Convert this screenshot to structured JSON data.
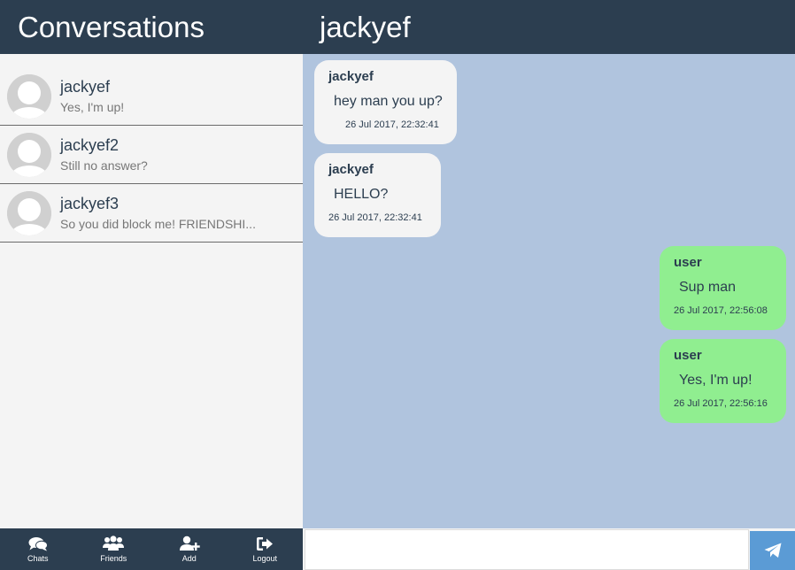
{
  "sidebar": {
    "title": "Conversations",
    "conversations": [
      {
        "name": "jackyef",
        "preview": "Yes, I'm up!"
      },
      {
        "name": "jackyef2",
        "preview": "Still no answer?"
      },
      {
        "name": "jackyef3",
        "preview": "So you did block me! FRIENDSHI..."
      }
    ]
  },
  "nav": {
    "items": [
      {
        "label": "Chats",
        "icon": "chat-bubbles-icon"
      },
      {
        "label": "Friends",
        "icon": "users-icon"
      },
      {
        "label": "Add",
        "icon": "user-plus-icon"
      },
      {
        "label": "Logout",
        "icon": "logout-icon"
      }
    ]
  },
  "chat": {
    "title": "jackyef",
    "messages": [
      {
        "sender": "jackyef",
        "text": "hey man you up?",
        "time": "26 Jul 2017, 22:32:41",
        "direction": "incoming"
      },
      {
        "sender": "jackyef",
        "text": "HELLO?",
        "time": "26 Jul 2017, 22:32:41",
        "direction": "incoming"
      },
      {
        "sender": "user",
        "text": "Sup man",
        "time": "26 Jul 2017, 22:56:08",
        "direction": "outgoing"
      },
      {
        "sender": "user",
        "text": "Yes, I'm up!",
        "time": "26 Jul 2017, 22:56:16",
        "direction": "outgoing"
      }
    ]
  },
  "composer": {
    "value": "",
    "send_icon": "paper-plane-icon"
  },
  "colors": {
    "header": "#2c3e50",
    "chat_background": "#b0c4de",
    "incoming_bubble": "#f4f4f4",
    "outgoing_bubble": "#90ee90",
    "send_button": "#5b9bd5"
  }
}
